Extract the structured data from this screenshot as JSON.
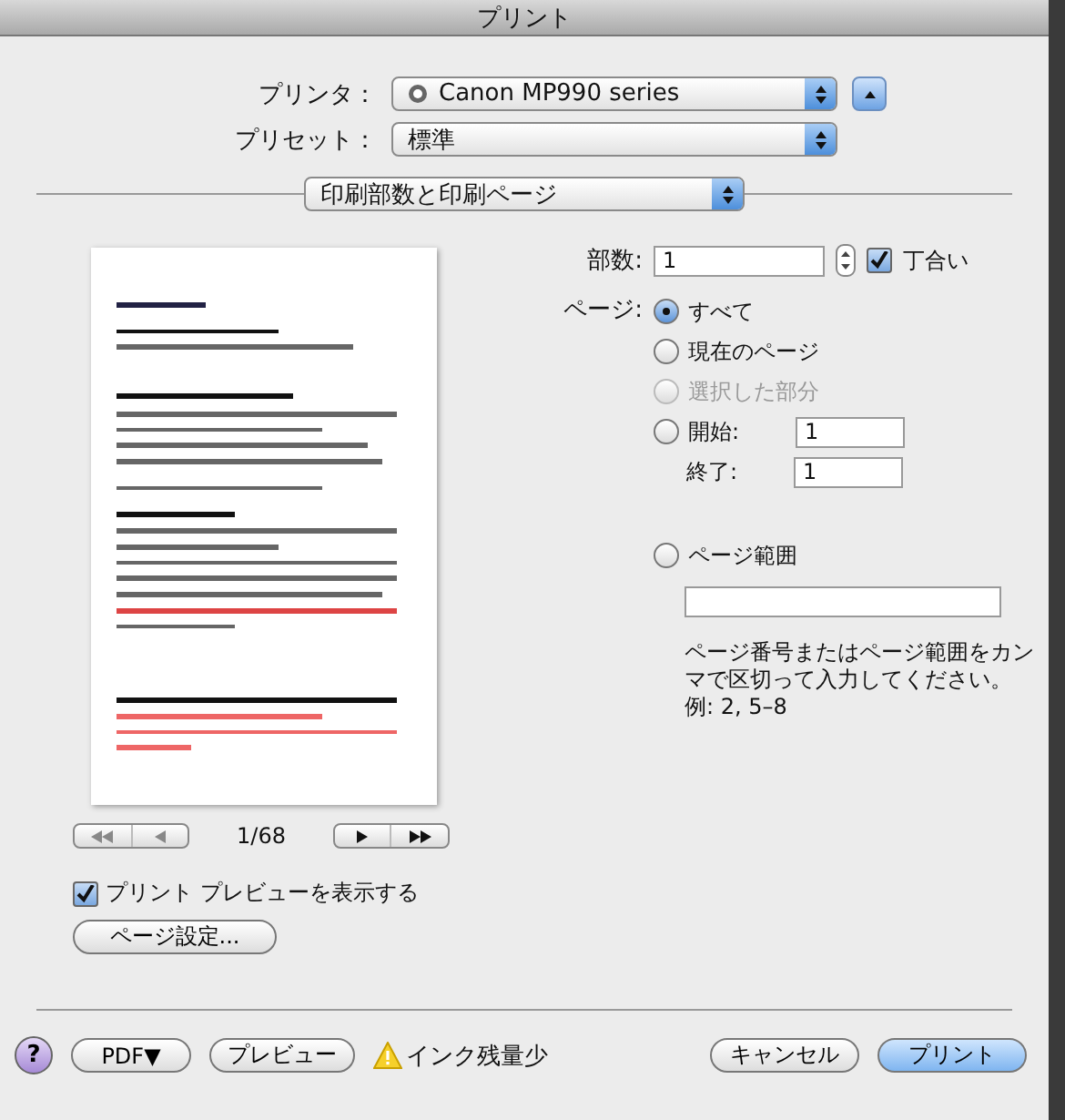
{
  "window": {
    "title": "プリント"
  },
  "printer": {
    "label": "プリンタ：",
    "value": "Canon MP990 series"
  },
  "preset": {
    "label": "プリセット：",
    "value": "標準"
  },
  "section_menu": {
    "value": "印刷部数と印刷ページ"
  },
  "preview": {
    "page_indicator": "1/68"
  },
  "show_preview": {
    "label": "プリント プレビューを表示する",
    "checked": true
  },
  "page_setup_button": "ページ設定...",
  "copies": {
    "label": "部数:",
    "value": "1",
    "collate": {
      "label": "丁合い",
      "checked": true
    }
  },
  "pages": {
    "label": "ページ:",
    "options": [
      {
        "kind": "radio",
        "label": "すべて",
        "selected": true,
        "disabled": false
      },
      {
        "kind": "radio",
        "label": "現在のページ",
        "selected": false,
        "disabled": false
      },
      {
        "kind": "radio",
        "label": "選択した部分",
        "selected": false,
        "disabled": true
      },
      {
        "kind": "from",
        "label": "開始:",
        "value": "1",
        "selected": false,
        "disabled": false
      }
    ],
    "to": {
      "label": "終了:",
      "value": "1"
    },
    "range": {
      "label": "ページ範囲",
      "selected": false,
      "hint": "ページ番号またはページ範囲をカンマで区切って入力してください。",
      "example": "例: 2, 5–8"
    }
  },
  "footer": {
    "help": "?",
    "pdf": "PDF▼",
    "preview": "プレビュー",
    "warning": "インク残量少",
    "cancel": "キャンセル",
    "print": "プリント"
  }
}
